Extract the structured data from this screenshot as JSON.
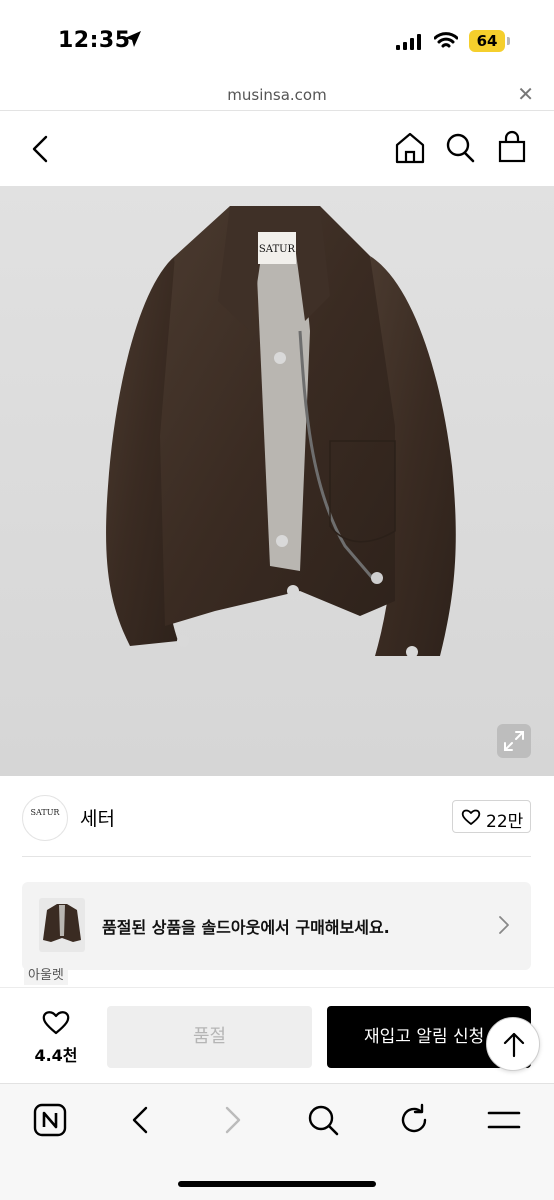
{
  "status_bar": {
    "time": "12:35",
    "battery": "64"
  },
  "url_bar": {
    "url": "musinsa.com"
  },
  "brand": {
    "logo_text": "SATUR",
    "name": "세터",
    "likes": "22만"
  },
  "banner": {
    "text": "품절된 상품을 솔드아웃에서 구매해보세요.",
    "tag": "아울렛"
  },
  "product_image": {
    "label_text": "SATUR"
  },
  "purchase": {
    "wish_count": "4.4천",
    "soldout_label": "품절",
    "restock_label": "재입고 알림 신청"
  },
  "colors": {
    "accent": "#000000",
    "battery": "#f5cf2c",
    "jacket": "#3a2b22"
  }
}
